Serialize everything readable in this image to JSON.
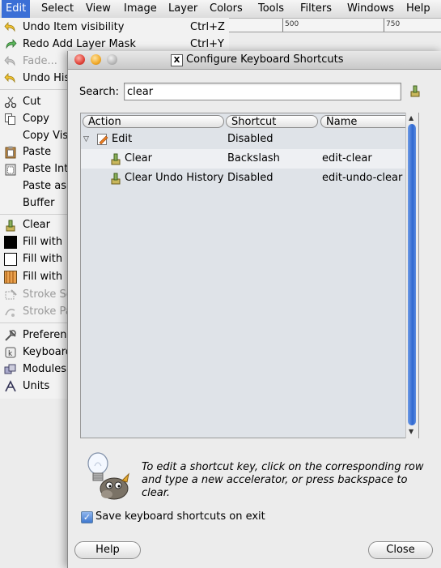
{
  "menubar": {
    "items": [
      "Edit",
      "Select",
      "View",
      "Image",
      "Layer",
      "Colors",
      "Tools",
      "Filters",
      "Windows",
      "Help"
    ]
  },
  "ruler": {
    "ticks": [
      "500",
      "750"
    ]
  },
  "edit_menu": {
    "items": [
      {
        "label": "Undo Item visibility",
        "accel": "Ctrl+Z",
        "icon": "undo-icon",
        "enabled": true
      },
      {
        "label": "Redo Add Layer Mask",
        "accel": "Ctrl+Y",
        "icon": "redo-icon",
        "enabled": true
      },
      {
        "label": "Fade...",
        "accel": "",
        "icon": "fade-icon",
        "enabled": false
      },
      {
        "label": "Undo His",
        "accel": "",
        "icon": "undo-history-icon",
        "enabled": true
      },
      {
        "label": "Cut",
        "accel": "",
        "icon": "cut-icon",
        "enabled": true
      },
      {
        "label": "Copy",
        "accel": "",
        "icon": "copy-icon",
        "enabled": true
      },
      {
        "label": "Copy Vis",
        "accel": "",
        "icon": "",
        "enabled": true
      },
      {
        "label": "Paste",
        "accel": "",
        "icon": "paste-icon",
        "enabled": true
      },
      {
        "label": "Paste Into",
        "accel": "",
        "icon": "paste-into-icon",
        "enabled": true
      },
      {
        "label": "Paste as",
        "accel": "",
        "icon": "",
        "enabled": true
      },
      {
        "label": "Buffer",
        "accel": "",
        "icon": "",
        "enabled": true
      },
      {
        "label": "Clear",
        "accel": "",
        "icon": "clear-icon",
        "enabled": true
      },
      {
        "label": "Fill with",
        "accel": "",
        "icon": "fill-fg-icon",
        "enabled": true
      },
      {
        "label": "Fill with",
        "accel": "",
        "icon": "fill-bg-icon",
        "enabled": true
      },
      {
        "label": "Fill with",
        "accel": "",
        "icon": "fill-pattern-icon",
        "enabled": true
      },
      {
        "label": "Stroke Se",
        "accel": "",
        "icon": "stroke-selection-icon",
        "enabled": false
      },
      {
        "label": "Stroke Pa",
        "accel": "",
        "icon": "stroke-path-icon",
        "enabled": false
      },
      {
        "label": "Preferenc",
        "accel": "",
        "icon": "preferences-icon",
        "enabled": true
      },
      {
        "label": "Keyboard",
        "accel": "",
        "icon": "keyboard-icon",
        "enabled": true
      },
      {
        "label": "Modules",
        "accel": "",
        "icon": "modules-icon",
        "enabled": true
      },
      {
        "label": "Units",
        "accel": "",
        "icon": "units-icon",
        "enabled": true
      }
    ]
  },
  "dialog": {
    "title": "Configure Keyboard Shortcuts",
    "search_label": "Search:",
    "search_value": "clear",
    "columns": [
      "Action",
      "Shortcut",
      "Name"
    ],
    "rows": [
      {
        "action": "Edit",
        "shortcut": "Disabled",
        "name": "",
        "level": 0
      },
      {
        "action": "Clear",
        "shortcut": "Backslash",
        "name": "edit-clear",
        "level": 1
      },
      {
        "action": "Clear Undo History",
        "shortcut": "Disabled",
        "name": "edit-undo-clear",
        "level": 1
      }
    ],
    "info_text": "To edit a shortcut key, click on the corresponding row and type a new accelerator, or press backspace to clear.",
    "save_checkbox_label": "Save keyboard shortcuts on exit",
    "save_checked": true,
    "help_button": "Help",
    "close_button": "Close"
  }
}
